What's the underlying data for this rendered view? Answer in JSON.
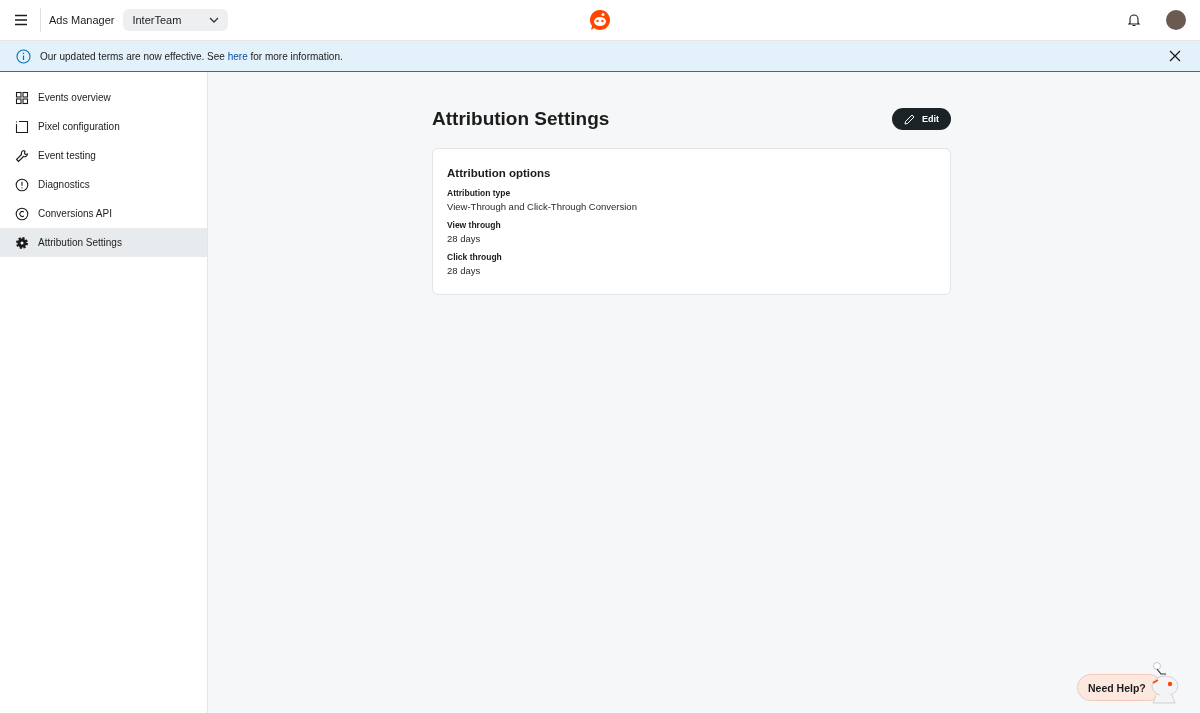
{
  "header": {
    "app_title": "Ads Manager",
    "account_select": {
      "value": "InterTeam"
    }
  },
  "banner": {
    "text_before": "Our updated terms are now effective. See ",
    "link": "here",
    "text_after": " for more information."
  },
  "sidebar": {
    "items": [
      {
        "label": "Events overview",
        "kind": "grid",
        "selected": false
      },
      {
        "label": "Pixel configuration",
        "kind": "pixel",
        "selected": false
      },
      {
        "label": "Event testing",
        "kind": "wrench",
        "selected": false
      },
      {
        "label": "Diagnostics",
        "kind": "alert",
        "selected": false
      },
      {
        "label": "Conversions API",
        "kind": "capi",
        "selected": false
      },
      {
        "label": "Attribution Settings",
        "kind": "gear",
        "selected": true
      }
    ]
  },
  "page": {
    "title": "Attribution Settings",
    "edit_button": "Edit",
    "card": {
      "title": "Attribution options",
      "fields": [
        {
          "label": "Attribution type",
          "value": "View-Through and Click-Through Conversion"
        },
        {
          "label": "View through",
          "value": "28 days"
        },
        {
          "label": "Click through",
          "value": "28 days"
        }
      ]
    }
  },
  "help_button": "Need Help?"
}
